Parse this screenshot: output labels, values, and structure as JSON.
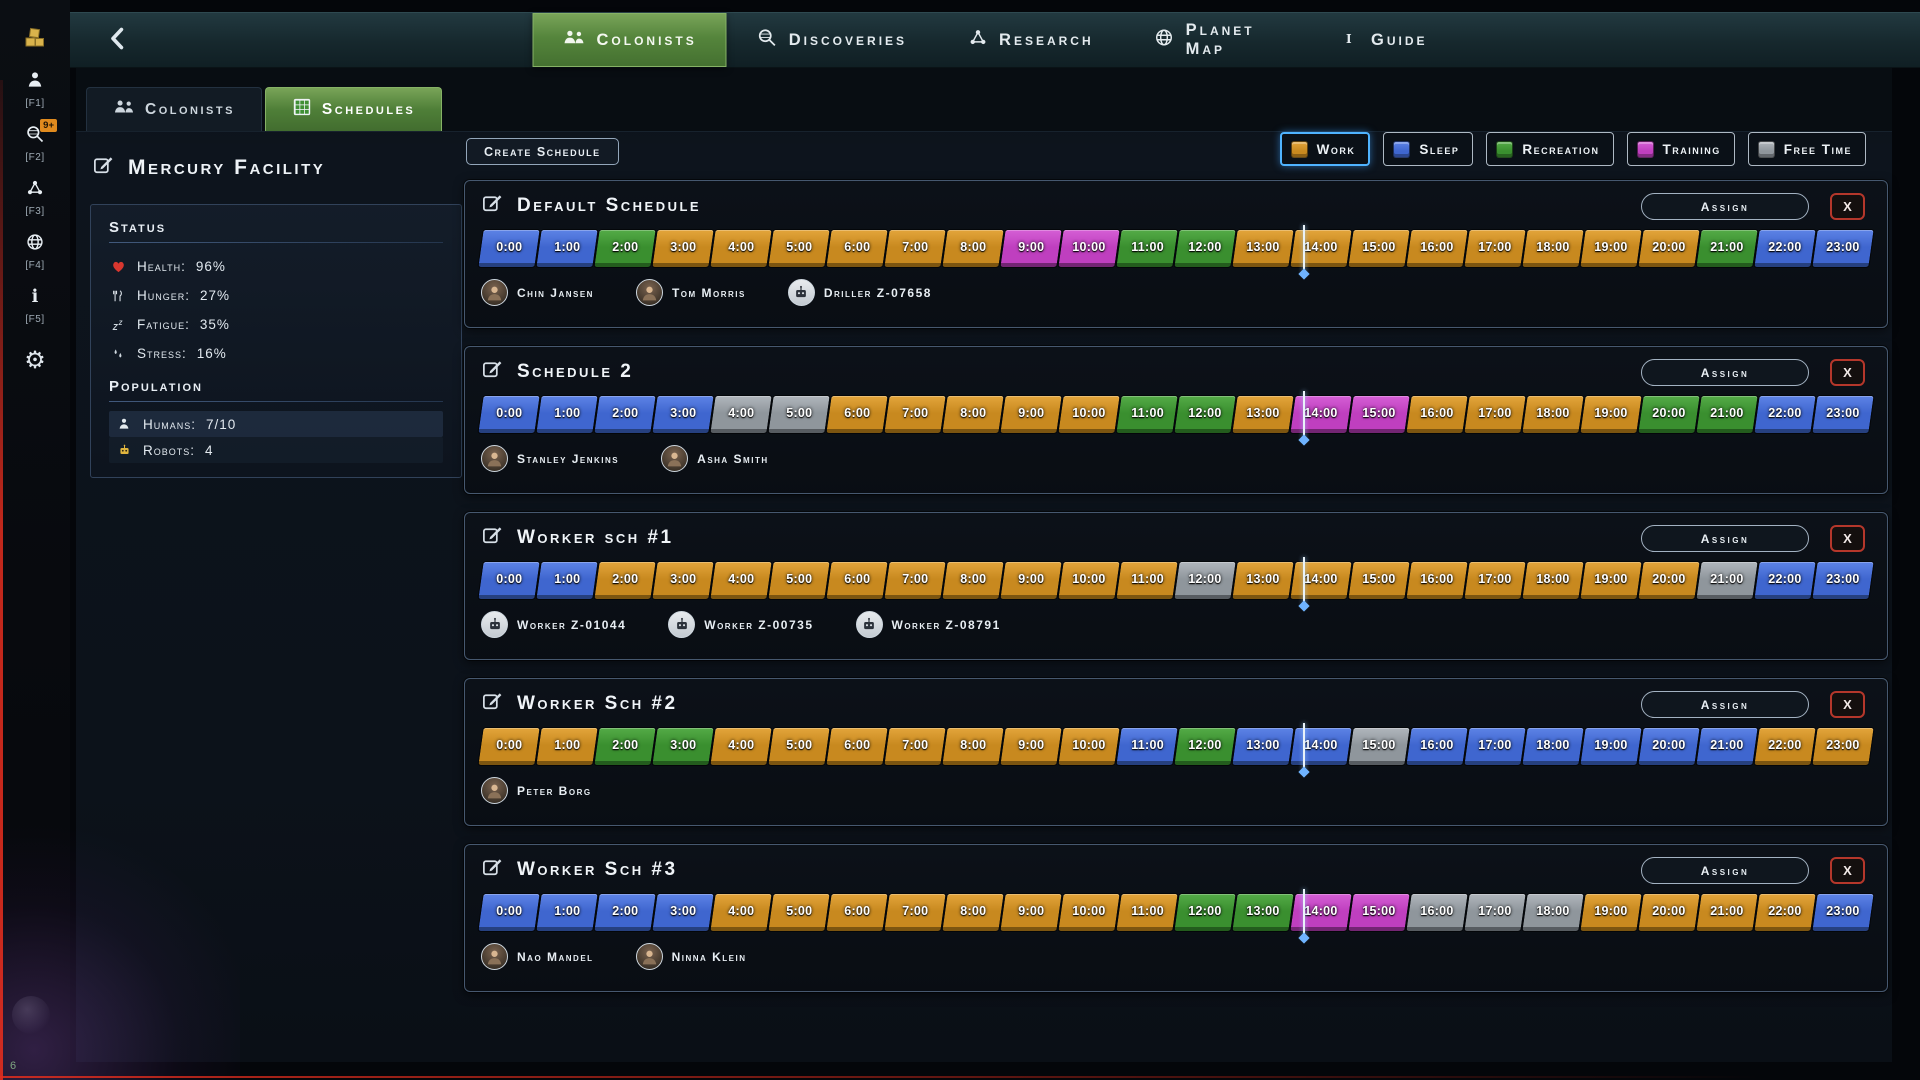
{
  "topbar": {
    "tabs": [
      {
        "label": "Colonists",
        "active": true
      },
      {
        "label": "Discoveries",
        "active": false
      },
      {
        "label": "Research",
        "active": false
      },
      {
        "label": "Planet Map",
        "active": false
      },
      {
        "label": "Guide",
        "active": false
      }
    ]
  },
  "rail": {
    "items": [
      {
        "name": "resources",
        "key": ""
      },
      {
        "name": "colonists",
        "key": "[F1]"
      },
      {
        "name": "discoveries",
        "key": "[F2]",
        "badge": "9+"
      },
      {
        "name": "research",
        "key": "[F3]"
      },
      {
        "name": "planet-map",
        "key": "[F4]"
      },
      {
        "name": "guide",
        "key": "[F5]"
      },
      {
        "name": "settings",
        "key": ""
      }
    ],
    "bottom_number": "6"
  },
  "subtabs": [
    {
      "label": "Colonists",
      "active": false
    },
    {
      "label": "Schedules",
      "active": true
    }
  ],
  "facility": {
    "title": "Mercury Facility",
    "status_heading": "Status",
    "stats": [
      {
        "label": "Health:",
        "value": "96%"
      },
      {
        "label": "Hunger:",
        "value": "27%"
      },
      {
        "label": "Fatigue:",
        "value": "35%"
      },
      {
        "label": "Stress:",
        "value": "16%"
      }
    ],
    "population_heading": "Population",
    "population": [
      {
        "label": "Humans:",
        "value": "7/10"
      },
      {
        "label": "Robots:",
        "value": "4"
      }
    ]
  },
  "toolbar": {
    "create_schedule_label": "Create Schedule"
  },
  "legend": [
    {
      "key": "work",
      "label": "Work",
      "selected": true
    },
    {
      "key": "sleep",
      "label": "Sleep",
      "selected": false
    },
    {
      "key": "recreation",
      "label": "Recreation",
      "selected": false
    },
    {
      "key": "training",
      "label": "Training",
      "selected": false
    },
    {
      "key": "free",
      "label": "Free Time",
      "selected": false
    }
  ],
  "activities": {
    "work": {
      "name": "Work",
      "color": "#c8891f",
      "hi": "#e3a53b",
      "shade": "#7c5510"
    },
    "sleep": {
      "name": "Sleep",
      "color": "#3f66cf",
      "hi": "#5d83e6",
      "shade": "#26407f"
    },
    "recreation": {
      "name": "Recreation",
      "color": "#3a8f2f",
      "hi": "#54ab47",
      "shade": "#235c1d"
    },
    "training": {
      "name": "Training",
      "color": "#bf3fbf",
      "hi": "#d55fd5",
      "shade": "#732573"
    },
    "free": {
      "name": "Free Time",
      "color": "#8f969c",
      "hi": "#b0b6bc",
      "shade": "#575c61"
    }
  },
  "hours": [
    "0:00",
    "1:00",
    "2:00",
    "3:00",
    "4:00",
    "5:00",
    "6:00",
    "7:00",
    "8:00",
    "9:00",
    "10:00",
    "11:00",
    "12:00",
    "13:00",
    "14:00",
    "15:00",
    "16:00",
    "17:00",
    "18:00",
    "19:00",
    "20:00",
    "21:00",
    "22:00",
    "23:00"
  ],
  "labels": {
    "assign": "Assign",
    "close": "X"
  },
  "time_cursor": {
    "hour": 14.2
  },
  "schedules": [
    {
      "title": "Default Schedule",
      "activities": [
        "sleep",
        "sleep",
        "recreation",
        "work",
        "work",
        "work",
        "work",
        "work",
        "work",
        "training",
        "training",
        "recreation",
        "recreation",
        "work",
        "work",
        "work",
        "work",
        "work",
        "work",
        "work",
        "work",
        "recreation",
        "sleep",
        "sleep"
      ],
      "members": [
        {
          "name": "Chin Jansen",
          "type": "human"
        },
        {
          "name": "Tom Morris",
          "type": "human"
        },
        {
          "name": "Driller Z-07658",
          "type": "robot"
        }
      ]
    },
    {
      "title": "Schedule 2",
      "activities": [
        "sleep",
        "sleep",
        "sleep",
        "sleep",
        "free",
        "free",
        "work",
        "work",
        "work",
        "work",
        "work",
        "recreation",
        "recreation",
        "work",
        "training",
        "training",
        "work",
        "work",
        "work",
        "work",
        "recreation",
        "recreation",
        "sleep",
        "sleep"
      ],
      "members": [
        {
          "name": "Stanley Jenkins",
          "type": "human"
        },
        {
          "name": "Asha Smith",
          "type": "human"
        }
      ]
    },
    {
      "title": "Worker sch #1",
      "activities": [
        "sleep",
        "sleep",
        "work",
        "work",
        "work",
        "work",
        "work",
        "work",
        "work",
        "work",
        "work",
        "work",
        "free",
        "work",
        "work",
        "work",
        "work",
        "work",
        "work",
        "work",
        "work",
        "free",
        "sleep",
        "sleep"
      ],
      "members": [
        {
          "name": "Worker Z-01044",
          "type": "robot"
        },
        {
          "name": "Worker Z-00735",
          "type": "robot"
        },
        {
          "name": "Worker Z-08791",
          "type": "robot"
        }
      ]
    },
    {
      "title": "Worker Sch #2",
      "activities": [
        "work",
        "work",
        "recreation",
        "recreation",
        "work",
        "work",
        "work",
        "work",
        "work",
        "work",
        "work",
        "sleep",
        "recreation",
        "sleep",
        "sleep",
        "free",
        "sleep",
        "sleep",
        "sleep",
        "sleep",
        "sleep",
        "sleep",
        "work",
        "work"
      ],
      "members": [
        {
          "name": "Peter Borg",
          "type": "human"
        }
      ]
    },
    {
      "title": "Worker Sch #3",
      "activities": [
        "sleep",
        "sleep",
        "sleep",
        "sleep",
        "work",
        "work",
        "work",
        "work",
        "work",
        "work",
        "work",
        "work",
        "recreation",
        "recreation",
        "training",
        "training",
        "free",
        "free",
        "free",
        "work",
        "work",
        "work",
        "work",
        "sleep"
      ],
      "members": [
        {
          "name": "Nao Mandel",
          "type": "human"
        },
        {
          "name": "Ninna Klein",
          "type": "human"
        }
      ]
    }
  ]
}
